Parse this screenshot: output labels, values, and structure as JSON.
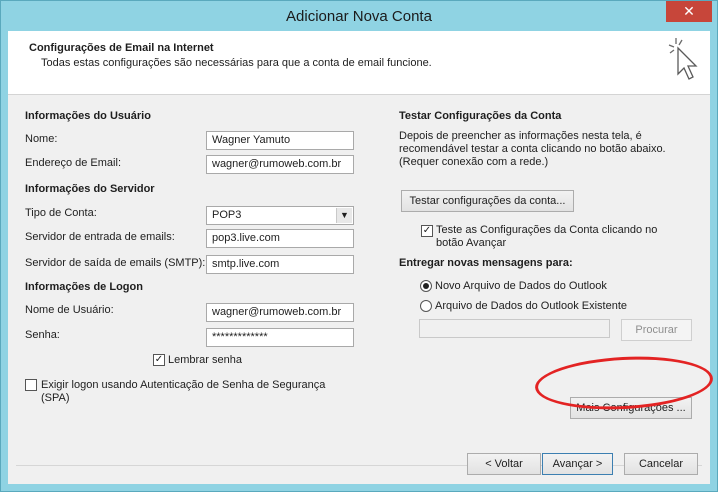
{
  "window": {
    "title": "Adicionar Nova Conta",
    "close_symbol": "✕"
  },
  "header": {
    "title": "Configurações de Email na Internet",
    "subtitle": "Todas estas configurações são necessárias para que a conta de email funcione.",
    "icon": "cursor-click-icon"
  },
  "user_info": {
    "section": "Informações do Usuário",
    "name_label": "Nome:",
    "name_value": "Wagner Yamuto",
    "email_label": "Endereço de Email:",
    "email_value": "wagner@rumoweb.com.br"
  },
  "server_info": {
    "section": "Informações do Servidor",
    "account_type_label": "Tipo de Conta:",
    "account_type_value": "POP3",
    "incoming_label": "Servidor de entrada de emails:",
    "incoming_value": "pop3.live.com",
    "outgoing_label": "Servidor de saída de emails (SMTP):",
    "outgoing_value": "smtp.live.com"
  },
  "logon_info": {
    "section": "Informações de Logon",
    "username_label": "Nome de Usuário:",
    "username_value": "wagner@rumoweb.com.br",
    "password_label": "Senha:",
    "password_value": "*************",
    "remember_label": "Lembrar senha",
    "remember_checked": true,
    "spa_label_line1": "Exigir logon usando Autenticação de Senha de Segurança",
    "spa_label_line2": "(SPA)",
    "spa_checked": false
  },
  "test_settings": {
    "section": "Testar Configurações da Conta",
    "desc_line1": "Depois de preencher as informações nesta tela, é",
    "desc_line2": "recomendável testar a conta clicando no botão abaixo.",
    "desc_line3": "(Requer conexão com a rede.)",
    "test_button": "Testar configurações da conta...",
    "auto_test_line1": "Teste as Configurações da Conta clicando no",
    "auto_test_line2": "botão Avançar",
    "auto_test_checked": true
  },
  "delivery": {
    "section": "Entregar novas mensagens para:",
    "option_new": "Novo Arquivo de Dados do Outlook",
    "option_existing": "Arquivo de Dados do Outlook Existente",
    "selected": "Novo Arquivo de Dados do Outlook",
    "path_value": "",
    "browse_button": "Procurar"
  },
  "more_settings_button": "Mais Configurações ...",
  "footer": {
    "back_button": "< Voltar",
    "next_button": "Avançar >",
    "cancel_button": "Cancelar"
  },
  "colors": {
    "titlebar": "#8fd3e3",
    "close": "#c7463a",
    "highlight_ellipse": "#e32323"
  }
}
